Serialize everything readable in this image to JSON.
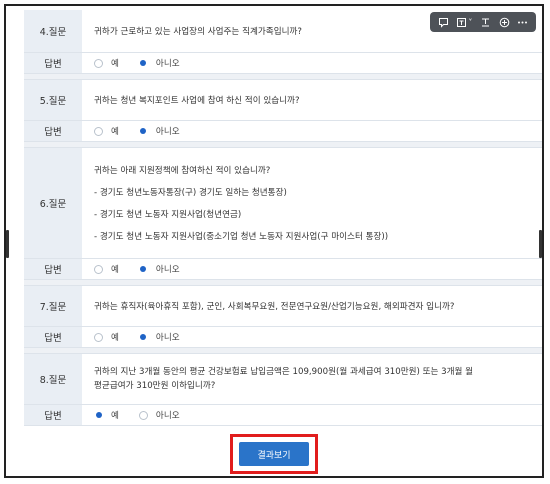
{
  "toolbar": {
    "icons": [
      "comment-icon",
      "text-box-icon",
      "text-icon",
      "plus-circle-icon",
      "more-icon"
    ],
    "dropdown_caret": "˅"
  },
  "questions": [
    {
      "label": "4.질문",
      "text": "귀하가 근로하고 있는 사업장의 사업주는 직계가족입니까?",
      "answer_label": "답변",
      "options": [
        {
          "label": "예",
          "selected": false
        },
        {
          "label": "아니오",
          "selected": true
        }
      ]
    },
    {
      "label": "5.질문",
      "text": "귀하는 청년 복지포인트 사업에 참여 하신 적이 있습니까?",
      "answer_label": "답변",
      "options": [
        {
          "label": "예",
          "selected": false
        },
        {
          "label": "아니오",
          "selected": true
        }
      ]
    },
    {
      "label": "6.질문",
      "lines": [
        "귀하는 아래 지원정책에 참여하신 적이 있습니까?",
        "- 경기도 청년노동자통장(구) 경기도 일하는 청년통장)",
        "- 경기도 청년 노동자 지원사업(청년연금)",
        "- 경기도 청년 노동자 지원사업(중소기업 청년 노동자 지원사업(구 마이스터 통장))"
      ],
      "answer_label": "답변",
      "options": [
        {
          "label": "예",
          "selected": false
        },
        {
          "label": "아니오",
          "selected": true
        }
      ]
    },
    {
      "label": "7.질문",
      "text": "귀하는 휴직자(육아휴직 포함), 군인, 사회복무요원, 전문연구요원/산업기능요원, 해외파견자 입니까?",
      "answer_label": "답변",
      "options": [
        {
          "label": "예",
          "selected": false
        },
        {
          "label": "아니오",
          "selected": true
        }
      ]
    },
    {
      "label": "8.질문",
      "lines": [
        "귀하의 지난 3개월 동안의 평균 건강보험료 납입금액은 109,900원(월 과세급여 310만원) 또는 3개월 월",
        "평균급여가 310만원 이하입니까?"
      ],
      "answer_label": "답변",
      "options": [
        {
          "label": "예",
          "selected": true
        },
        {
          "label": "아니오",
          "selected": false
        }
      ]
    }
  ],
  "result_button": "결과보기"
}
